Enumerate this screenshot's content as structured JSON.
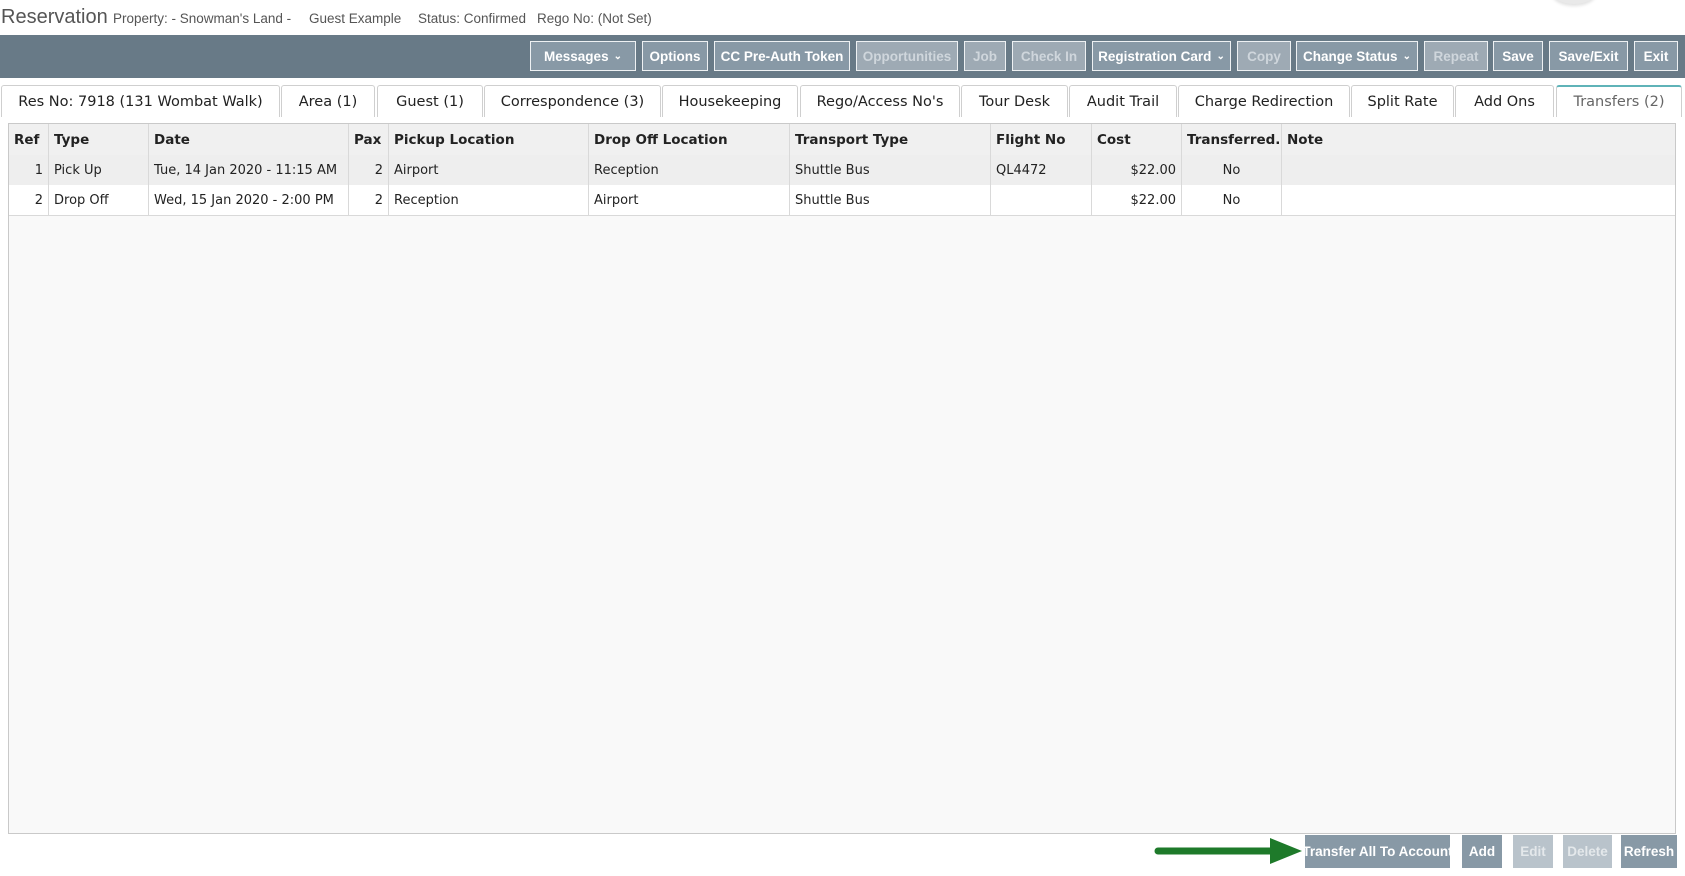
{
  "header": {
    "title": "Reservation",
    "property": "Property: - Snowman's Land -",
    "guest": "Guest Example",
    "status": "Status: Confirmed",
    "rego": "Rego No: (Not Set)"
  },
  "toolbar": {
    "messages": "Messages",
    "options": "Options",
    "cc_preauth": "CC Pre-Auth Token",
    "opportunities": "Opportunities",
    "job": "Job",
    "check_in": "Check In",
    "registration_card": "Registration Card",
    "copy": "Copy",
    "change_status": "Change Status",
    "repeat": "Repeat",
    "save": "Save",
    "save_exit": "Save/Exit",
    "exit": "Exit"
  },
  "tabs": [
    "Res No: 7918 (131 Wombat Walk)",
    "Area (1)",
    "Guest (1)",
    "Correspondence (3)",
    "Housekeeping",
    "Rego/Access No's",
    "Tour Desk",
    "Audit Trail",
    "Charge Redirection",
    "Split Rate",
    "Add Ons",
    "Transfers (2)"
  ],
  "active_tab": "Transfers (2)",
  "table": {
    "columns": [
      "Ref",
      "Type",
      "Date",
      "Pax",
      "Pickup Location",
      "Drop Off Location",
      "Transport Type",
      "Flight No",
      "Cost",
      "Transferred...",
      "Note"
    ],
    "rows": [
      {
        "ref": "1",
        "type": "Pick Up",
        "date": "Tue, 14 Jan 2020 - 11:15 AM",
        "pax": "2",
        "pickup": "Airport",
        "dropoff": "Reception",
        "transport": "Shuttle Bus",
        "flight": "QL4472",
        "cost": "$22.00",
        "transferred": "No",
        "note": ""
      },
      {
        "ref": "2",
        "type": "Drop Off",
        "date": "Wed, 15 Jan 2020 - 2:00 PM",
        "pax": "2",
        "pickup": "Reception",
        "dropoff": "Airport",
        "transport": "Shuttle Bus",
        "flight": "",
        "cost": "$22.00",
        "transferred": "No",
        "note": ""
      }
    ]
  },
  "bottom": {
    "transfer_all": "Transfer All To Account",
    "add": "Add",
    "edit": "Edit",
    "delete": "Delete",
    "refresh": "Refresh"
  },
  "colors": {
    "toolbar_bg": "#687a87",
    "button_bg": "#8899a6",
    "active_tab_accent": "#5fb3b8",
    "annotation_arrow": "#1e7a2a"
  }
}
